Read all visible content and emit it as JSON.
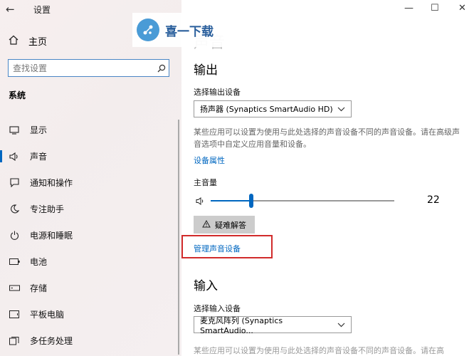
{
  "app": {
    "title": "设置",
    "back_glyph": "←"
  },
  "window": {
    "minimize": "—",
    "maximize": "☐",
    "close": "✕"
  },
  "sidebar": {
    "home_label": "主页",
    "search_placeholder": "查找设置",
    "section_label": "系统",
    "items": [
      {
        "label": "显示",
        "icon": "display-icon"
      },
      {
        "label": "声音",
        "icon": "speaker-icon",
        "active": true
      },
      {
        "label": "通知和操作",
        "icon": "notification-icon"
      },
      {
        "label": "专注助手",
        "icon": "moon-icon"
      },
      {
        "label": "电源和睡眠",
        "icon": "power-icon"
      },
      {
        "label": "电池",
        "icon": "battery-icon"
      },
      {
        "label": "存储",
        "icon": "storage-icon"
      },
      {
        "label": "平板电脑",
        "icon": "tablet-icon"
      },
      {
        "label": "多任务处理",
        "icon": "multitask-icon"
      }
    ]
  },
  "watermark": {
    "text": "喜一下载"
  },
  "main": {
    "page_title": "声音",
    "output_heading": "输出",
    "output_device_label": "选择输出设备",
    "output_device_value": "扬声器 (Synaptics SmartAudio HD)",
    "output_desc": "某些应用可以设置为使用与此处选择的声音设备不同的声音设备。请在高级声音选项中自定义应用音量和设备。",
    "device_properties_link": "设备属性",
    "master_volume_label": "主音量",
    "master_volume": 22,
    "troubleshoot_label": "疑难解答",
    "manage_devices_link": "管理声音设备",
    "input_heading": "输入",
    "input_device_label": "选择输入设备",
    "input_device_value": "麦克风阵列 (Synaptics SmartAudio...",
    "input_desc_partial": "某些应用可以设置为使用与此处选择的声音设备不同的声音设备。请在高"
  },
  "colors": {
    "accent": "#0067c0",
    "highlight": "#d12b2b"
  }
}
